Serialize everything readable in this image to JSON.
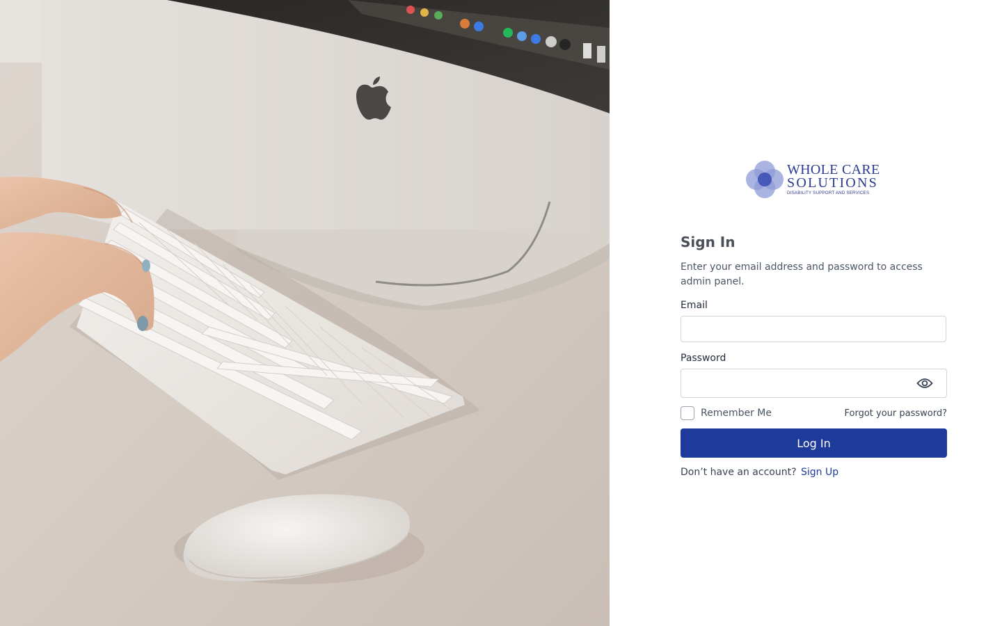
{
  "brand": {
    "name_line1": "WHOLE CARE",
    "name_line2": "SOLUTIONS",
    "tagline": "DISABILITY SUPPORT AND SERVICES",
    "color": "#2b3990"
  },
  "hero": {
    "image_subject": "hands typing on a white keyboard in front of a desktop computer with a mouse"
  },
  "signin": {
    "title": "Sign In",
    "subtitle": "Enter your email address and password to access admin panel.",
    "email_label": "Email",
    "email_value": "",
    "password_label": "Password",
    "password_value": "",
    "password_toggle_icon": "eye-icon",
    "remember_label": "Remember Me",
    "remember_checked": false,
    "forgot_label": "Forgot your password?",
    "login_label": "Log In",
    "no_account_text": "Don’t have an account?",
    "signup_label": "Sign Up"
  },
  "colors": {
    "primary": "#1e3a9b",
    "brand": "#2b3990"
  }
}
